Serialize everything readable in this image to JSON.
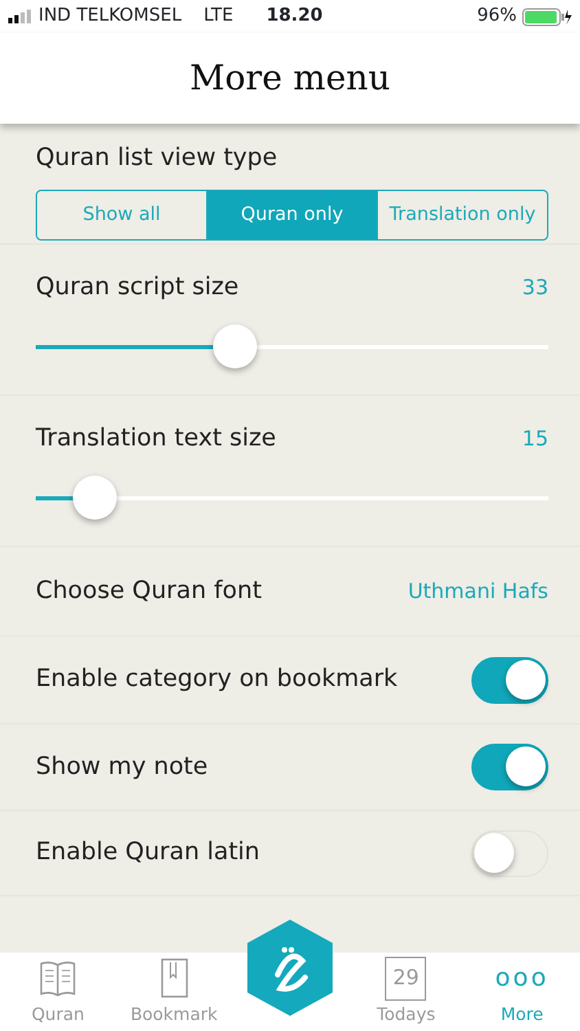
{
  "status_bar": {
    "carrier": "IND TELKOMSEL",
    "network": "LTE",
    "time": "18.20",
    "battery": "96%"
  },
  "header": {
    "title": "More menu"
  },
  "settings": [
    {
      "kind": "segmented",
      "label": "Quran list view type",
      "options": [
        {
          "label": "Show all",
          "selected": false
        },
        {
          "label": "Quran only",
          "selected": true
        },
        {
          "label": "Translation only",
          "selected": false
        }
      ]
    },
    {
      "kind": "slider",
      "label": "Quran script size",
      "reading": "33",
      "level": 0.39
    },
    {
      "kind": "slider",
      "label": "Translation text size",
      "reading": "15",
      "level": 0.115
    },
    {
      "kind": "value",
      "label": "Choose Quran font",
      "value": "Uthmani Hafs"
    },
    {
      "kind": "toggle",
      "label": "Enable category on bookmark",
      "on": true
    },
    {
      "kind": "toggle",
      "label": "Show my note",
      "on": true
    },
    {
      "kind": "toggle",
      "label": "Enable Quran latin",
      "on": false
    }
  ],
  "tab_bar": [
    {
      "kind": "book",
      "label": "Quran",
      "selected": false
    },
    {
      "kind": "bookmark",
      "label": "Bookmark",
      "selected": false
    },
    {
      "kind": "center"
    },
    {
      "kind": "calendar",
      "label": "Todays",
      "icon_text": "29",
      "selected": false
    },
    {
      "kind": "dots",
      "label": "More",
      "icon_text": "ooo",
      "selected": true
    }
  ]
}
